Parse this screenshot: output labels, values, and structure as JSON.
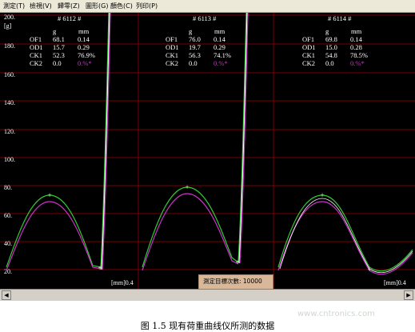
{
  "menu": [
    "測定(T)",
    "檢視(V)",
    "歸零(Z)",
    "圖形(G)",
    "顏色(C)",
    "列印(P)"
  ],
  "y_axis": {
    "unit": "[g]",
    "top_label": "200.",
    "ticks": [
      "180.",
      "160.",
      "140.",
      "120.",
      "100.",
      "80.",
      "60.",
      "40.",
      "20."
    ]
  },
  "panels": [
    {
      "title": "# 6112 #",
      "col_g": "g",
      "col_mm": "mm",
      "rows": [
        {
          "name": "OF1",
          "g": "68.1",
          "mm": "0.14"
        },
        {
          "name": "OD1",
          "g": "15.7",
          "mm": "0.29"
        },
        {
          "name": "CK1",
          "g": "52.3",
          "mm": "76.9%"
        },
        {
          "name": "CK2",
          "g": "0.0",
          "mm": "0.%*"
        }
      ]
    },
    {
      "title": "# 6113 #",
      "col_g": "g",
      "col_mm": "mm",
      "rows": [
        {
          "name": "OF1",
          "g": "76.0",
          "mm": "0.14"
        },
        {
          "name": "OD1",
          "g": "19.7",
          "mm": "0.29"
        },
        {
          "name": "CK1",
          "g": "56.3",
          "mm": "74.1%"
        },
        {
          "name": "CK2",
          "g": "0.0",
          "mm": "0.%*"
        }
      ]
    },
    {
      "title": "# 6114 #",
      "col_g": "g",
      "col_mm": "mm",
      "rows": [
        {
          "name": "OF1",
          "g": "69.8",
          "mm": "0.14"
        },
        {
          "name": "OD1",
          "g": "15.0",
          "mm": "0.28"
        },
        {
          "name": "CK1",
          "g": "54.8",
          "mm": "78.5%"
        },
        {
          "name": "CK2",
          "g": "0.0",
          "mm": "0.%*"
        }
      ]
    }
  ],
  "x_unit": "[mm]0.4",
  "popup": "測定目標次數: 10000",
  "colors": {
    "background": "#000000",
    "grid": "#7a0000",
    "text": "#ffffff",
    "ck2": "#cc33cc",
    "curve_green": "#33cc33",
    "curve_magenta": "#cc33cc",
    "curve_white": "#ffffff"
  },
  "caption": "图 1.5 现有荷重曲线仪所测的数据",
  "watermark": "www.cntronics.com"
}
